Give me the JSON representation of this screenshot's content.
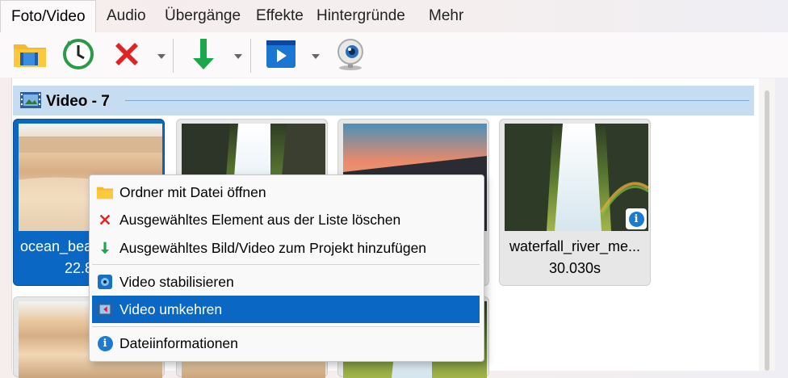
{
  "tabs": [
    {
      "label": "Foto/Video",
      "active": true
    },
    {
      "label": "Audio"
    },
    {
      "label": "Übergänge"
    },
    {
      "label": "Effekte"
    },
    {
      "label": "Hintergründe"
    },
    {
      "label": "Mehr"
    }
  ],
  "toolbar": {
    "buttons": [
      "folder-film-icon",
      "clock-icon",
      "delete-x-icon",
      "add-arrow-down-icon",
      "play-video-icon",
      "webcam-icon"
    ]
  },
  "group": {
    "title": "Video - 7"
  },
  "tiles": [
    {
      "name": "ocean_bea",
      "duration": "22.8",
      "selected": true
    },
    {
      "name": "",
      "duration": ""
    },
    {
      "name": "",
      "duration": ""
    },
    {
      "name": "waterfall_river_me...",
      "duration": "30.030s"
    }
  ],
  "context_menu": {
    "items": [
      {
        "label": "Ordner mit Datei öffnen",
        "icon": "folder-icon"
      },
      {
        "label": "Ausgewähltes Element aus der Liste löschen",
        "icon": "delete-x-icon"
      },
      {
        "label": "Ausgewähltes Bild/Video zum Projekt hinzufügen",
        "icon": "arrow-down-icon"
      },
      {
        "label": "Video stabilisieren",
        "icon": "stabilize-icon"
      },
      {
        "label": "Video umkehren",
        "icon": "reverse-video-icon",
        "highlighted": true
      },
      {
        "label": "Dateiinformationen",
        "icon": "info-icon"
      }
    ]
  },
  "colors": {
    "accent": "#0a67c3",
    "header": "#c6dcf0",
    "delete": "#e02424",
    "add": "#1aa84a"
  }
}
